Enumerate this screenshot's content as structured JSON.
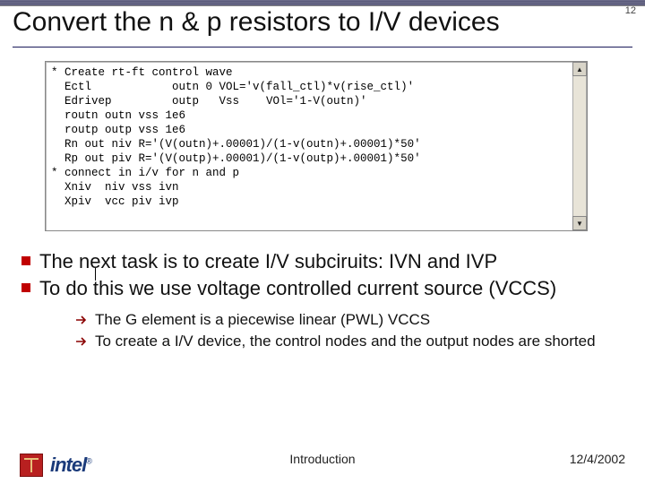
{
  "page_number": "12",
  "title": "Convert the n & p resistors to I/V devices",
  "code": "* Create rt-ft control wave\n  Ectl            outn 0 VOL='v(fall_ctl)*v(rise_ctl)'\n  Edrivep         outp   Vss    VOl='1-V(outn)'\n  routn outn vss 1e6\n  routp outp vss 1e6\n  Rn out niv R='(V(outn)+.00001)/(1-v(outn)+.00001)*50'\n  Rp out piv R='(V(outp)+.00001)/(1-v(outp)+.00001)*50'\n* connect in i/v for n and p\n  Xniv  niv vss ivn\n  Xpiv  vcc piv ivp",
  "bullets": [
    "The next task is to create I/V subciruits: IVN and IVP",
    "To do this we use voltage controlled current source (VCCS)"
  ],
  "subbullets": [
    "The G element is a piecewise linear (PWL) VCCS",
    "To create a I/V device, the control nodes and the output nodes are shorted"
  ],
  "footer": {
    "center": "Introduction",
    "right": "12/4/2002"
  },
  "logo_text": "intel"
}
